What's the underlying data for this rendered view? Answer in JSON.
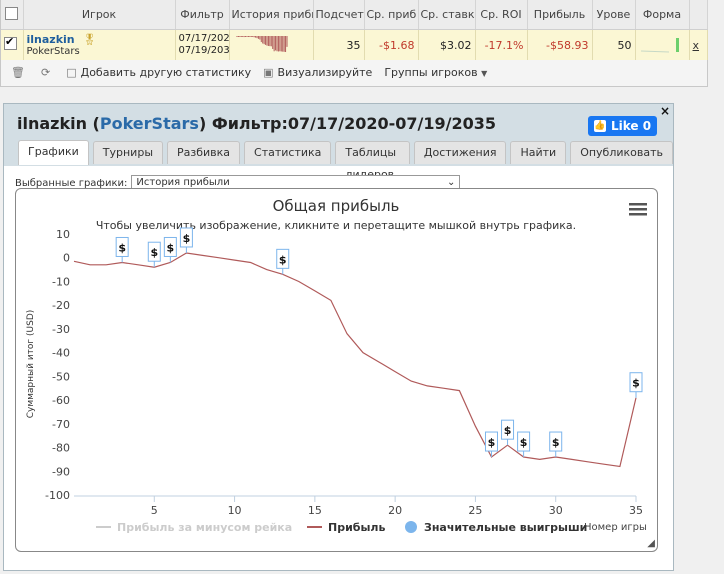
{
  "table": {
    "headers": [
      "",
      "Игрок",
      "Фильтр",
      "История прибы",
      "Подсчет",
      "Ср. приб",
      "Ср. ставк",
      "Ср. ROI",
      "Прибыль",
      "Урове",
      "Форма",
      ""
    ],
    "row": {
      "player": "ilnazkin",
      "site": "PokerStars",
      "filter_from": "07/17/202",
      "filter_to": "07/19/203",
      "count": "35",
      "avg_profit": "-$1.68",
      "avg_stake": "$3.02",
      "avg_roi": "-17.1%",
      "profit": "-$58.93",
      "level": "50",
      "remove": "x"
    }
  },
  "toolbar": {
    "add_stats": "Добавить другую статистику",
    "visualize": "Визуализируйте",
    "groups": "Группы игроков"
  },
  "popup": {
    "player": "ilnazkin",
    "site": "PokerStars",
    "filter": "Фильтр:07/17/2020-07/19/2035",
    "like": "Like 0",
    "close": "×",
    "tabs": [
      "Графики",
      "Турниры",
      "Разбивка",
      "Статистика",
      "Таблицы лидеров",
      "Достижения",
      "Найти",
      "Опубликовать"
    ],
    "select_label": "Выбранные графики:",
    "select_value": "История прибыли"
  },
  "chart_data": {
    "type": "line",
    "title": "Общая прибыль",
    "subtitle": "Чтобы увеличить изображение, кликните и перетащите мышкой внутрь графика.",
    "xlabel": "Номер игры",
    "ylabel": "Суммарный итог (USD)",
    "xlim": [
      0,
      35
    ],
    "ylim": [
      -100,
      10
    ],
    "x_ticks": [
      5,
      10,
      15,
      20,
      25,
      30,
      35
    ],
    "y_ticks": [
      10,
      0,
      -10,
      -20,
      -30,
      -40,
      -50,
      -60,
      -70,
      -80,
      -90,
      -100
    ],
    "series": [
      {
        "name": "Прибыль",
        "color": "#b05a5a",
        "x": [
          0,
          1,
          2,
          3,
          4,
          5,
          6,
          7,
          8,
          9,
          10,
          11,
          12,
          13,
          14,
          15,
          16,
          17,
          18,
          19,
          20,
          21,
          22,
          23,
          24,
          25,
          26,
          27,
          28,
          29,
          30,
          31,
          32,
          33,
          34,
          35
        ],
        "y": [
          -1.5,
          -3,
          -3,
          -2,
          -3,
          -4,
          -2,
          2,
          1,
          0,
          -1,
          -2,
          -5,
          -7,
          -10,
          -14,
          -18,
          -32,
          -40,
          -44,
          -48,
          -52,
          -54,
          -55,
          -56,
          -71,
          -84,
          -79,
          -84,
          -85,
          -84,
          -85,
          -86,
          -87,
          -88,
          -59
        ]
      }
    ],
    "disabled_series": "Прибыль за минусом рейка",
    "markers_series": "Значительные выигрыши",
    "markers": [
      {
        "x": 3,
        "y": -2,
        "label": "$"
      },
      {
        "x": 5,
        "y": -4,
        "label": "$"
      },
      {
        "x": 6,
        "y": -2,
        "label": "$"
      },
      {
        "x": 7,
        "y": 2,
        "label": "$"
      },
      {
        "x": 13,
        "y": -7,
        "label": "$"
      },
      {
        "x": 26,
        "y": -84,
        "label": "$"
      },
      {
        "x": 27,
        "y": -79,
        "label": "$"
      },
      {
        "x": 28,
        "y": -84,
        "label": "$"
      },
      {
        "x": 30,
        "y": -84,
        "label": "$"
      },
      {
        "x": 35,
        "y": -59,
        "label": "$"
      }
    ],
    "grid": false,
    "legend_position": "bottom"
  }
}
